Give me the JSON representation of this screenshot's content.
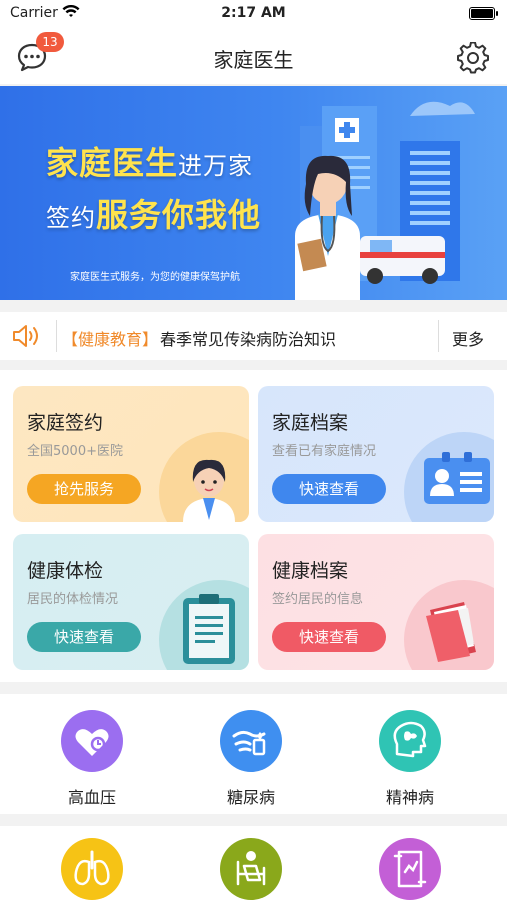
{
  "status": {
    "carrier": "Carrier",
    "time": "2:17 AM"
  },
  "navbar": {
    "title": "家庭医生",
    "badge": "13"
  },
  "banner": {
    "line1_highlight": "家庭医生",
    "line1_rest": "进万家",
    "line2_lead": "签约",
    "line2_highlight": "服务你我他",
    "subtitle": "家庭医生式服务，为您的健康保驾护航"
  },
  "notice": {
    "tag": "【健康教育】",
    "text": "春季常见传染病防治知识",
    "more": "更多"
  },
  "cards": [
    {
      "title": "家庭签约",
      "subtitle": "全国5000+医院",
      "button": "抢先服务"
    },
    {
      "title": "家庭档案",
      "subtitle": "查看已有家庭情况",
      "button": "快速查看"
    },
    {
      "title": "健康体检",
      "subtitle": "居民的体检情况",
      "button": "快速查看"
    },
    {
      "title": "健康档案",
      "subtitle": "签约居民的信息",
      "button": "快速查看"
    }
  ],
  "categories": [
    {
      "label": "高血压",
      "color": "#9b6ef0",
      "icon": "heart-pressure-icon"
    },
    {
      "label": "糖尿病",
      "color": "#3f8ff0",
      "icon": "diabetes-icon"
    },
    {
      "label": "精神病",
      "color": "#2fc4b4",
      "icon": "brain-icon"
    },
    {
      "label": "",
      "color": "#f6c315",
      "icon": "lungs-icon"
    },
    {
      "label": "",
      "color": "#8aa81b",
      "icon": "elderly-icon"
    },
    {
      "label": "",
      "color": "#c35fd6",
      "icon": "report-icon"
    }
  ],
  "colors": {
    "accent": "#3f87ee",
    "notice_tag": "#f08a2b",
    "badge": "#f15a3d"
  }
}
